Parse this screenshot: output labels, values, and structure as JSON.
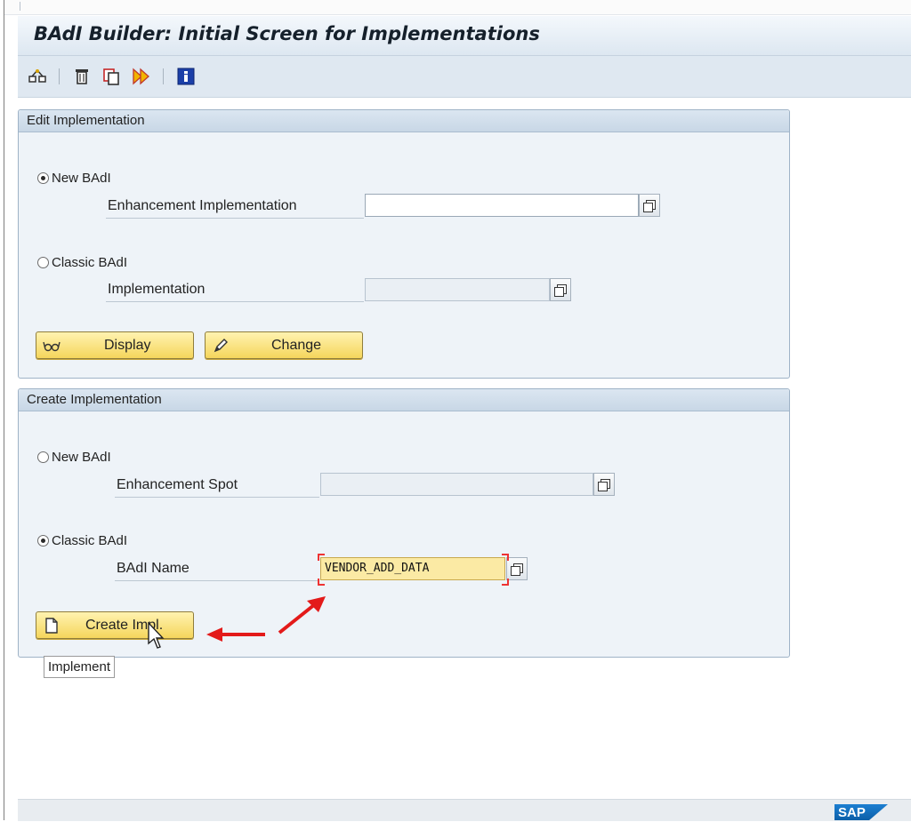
{
  "window": {
    "title": "BAdI Builder: Initial Screen for Implementations"
  },
  "toolbar": {
    "icons": [
      "other-object-icon",
      "delete-icon",
      "copy-icon",
      "rename-icon",
      "info-icon"
    ]
  },
  "edit_group": {
    "title": "Edit Implementation",
    "new_badi": {
      "label": "New BAdI",
      "selected": true,
      "field_label": "Enhancement Implementation",
      "value": ""
    },
    "classic_badi": {
      "label": "Classic BAdI",
      "selected": false,
      "field_label": "Implementation",
      "value": ""
    },
    "display_button": "Display",
    "change_button": "Change"
  },
  "create_group": {
    "title": "Create Implementation",
    "new_badi": {
      "label": "New BAdI",
      "selected": false,
      "field_label": "Enhancement Spot",
      "value": ""
    },
    "classic_badi": {
      "label": "Classic BAdI",
      "selected": true,
      "field_label": "BAdI Name",
      "value": "VENDOR_ADD_DATA"
    },
    "create_button": "Create Impl."
  },
  "tooltip": "Implement",
  "footer": {
    "logo_text": "SAP"
  },
  "colors": {
    "button_yellow": "#f5d65c",
    "active_input": "#fbeaa4",
    "annotation_red": "#e31a1a",
    "group_header": "#c8d7e6"
  }
}
